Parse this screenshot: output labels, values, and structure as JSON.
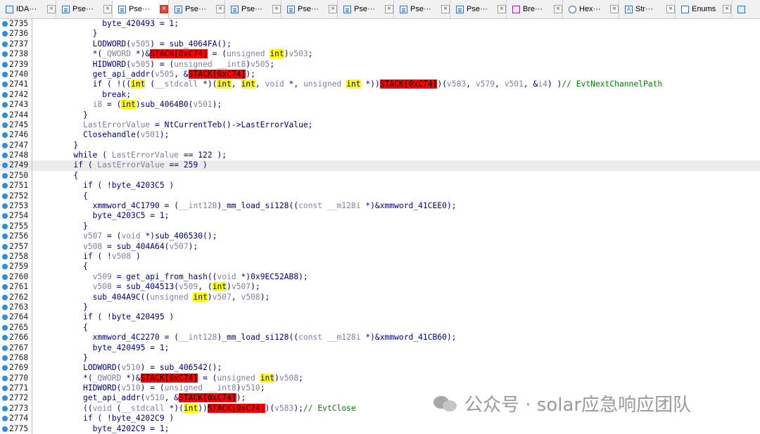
{
  "tabs": [
    {
      "label": "IDA···",
      "icon": "ida-view-icon",
      "active": false
    },
    {
      "label": "Pse···",
      "icon": "pseudocode-icon",
      "active": false
    },
    {
      "label": "Pse···",
      "icon": "pseudocode-icon",
      "active": true
    },
    {
      "label": "Pse···",
      "icon": "pseudocode-icon",
      "active": false
    },
    {
      "label": "Pse···",
      "icon": "pseudocode-icon",
      "active": false
    },
    {
      "label": "Pse···",
      "icon": "pseudocode-icon",
      "active": false
    },
    {
      "label": "Pse···",
      "icon": "pseudocode-icon",
      "active": false
    },
    {
      "label": "Pse···",
      "icon": "pseudocode-icon",
      "active": false
    },
    {
      "label": "Pse···",
      "icon": "pseudocode-icon",
      "active": false
    },
    {
      "label": "Bre···",
      "icon": "breakpoints-icon",
      "active": false
    },
    {
      "label": "Hex···",
      "icon": "hex-view-icon",
      "active": false
    },
    {
      "label": "Str···",
      "icon": "strings-icon",
      "active": false
    },
    {
      "label": "Enums",
      "icon": "enums-icon",
      "active": false
    },
    {
      "label": "",
      "icon": "tab-icon",
      "active": false
    }
  ],
  "highlighted_line": 2749,
  "lines": [
    {
      "n": 2735,
      "t": [
        [
          "p",
          "              byte_420493 = 1;"
        ]
      ]
    },
    {
      "n": 2736,
      "t": [
        [
          "p",
          "            }"
        ]
      ]
    },
    {
      "n": 2737,
      "t": [
        [
          "p",
          "            LODWORD("
        ],
        [
          "v",
          "v505"
        ],
        [
          "p",
          ") = sub_4064FA();"
        ]
      ]
    },
    {
      "n": 2738,
      "t": [
        [
          "p",
          "            *("
        ],
        [
          "v",
          "_QWORD"
        ],
        [
          "p",
          " *)&"
        ],
        [
          "s",
          "STACK[0xC74]"
        ],
        [
          "p",
          " = ("
        ],
        [
          "v",
          "unsigned"
        ],
        [
          "p",
          " "
        ],
        [
          "k",
          "int"
        ],
        [
          "p",
          ")"
        ],
        [
          "v",
          "v503"
        ],
        [
          "p",
          ";"
        ]
      ]
    },
    {
      "n": 2739,
      "t": [
        [
          "p",
          "            HIDWORD("
        ],
        [
          "v",
          "v505"
        ],
        [
          "p",
          ") = ("
        ],
        [
          "v",
          "unsigned __int8"
        ],
        [
          "p",
          ")"
        ],
        [
          "v",
          "v505"
        ],
        [
          "p",
          ";"
        ]
      ]
    },
    {
      "n": 2740,
      "t": [
        [
          "p",
          "            get_api_addr("
        ],
        [
          "v",
          "v505"
        ],
        [
          "p",
          ", &"
        ],
        [
          "s",
          "STACK[0xC74]"
        ],
        [
          "p",
          ");"
        ]
      ]
    },
    {
      "n": 2741,
      "t": [
        [
          "p",
          "            if ( !(("
        ],
        [
          "k",
          "int"
        ],
        [
          "p",
          " ("
        ],
        [
          "v",
          "__stdcall"
        ],
        [
          "p",
          " *)("
        ],
        [
          "k",
          "int"
        ],
        [
          "p",
          ", "
        ],
        [
          "k",
          "int"
        ],
        [
          "p",
          ", "
        ],
        [
          "v",
          "void"
        ],
        [
          "p",
          " *, "
        ],
        [
          "v",
          "unsigned"
        ],
        [
          "p",
          " "
        ],
        [
          "k",
          "int"
        ],
        [
          "p",
          " *))"
        ],
        [
          "s",
          "STACK[0xC74]"
        ],
        [
          "p",
          ")("
        ],
        [
          "v",
          "v583"
        ],
        [
          "p",
          ", "
        ],
        [
          "v",
          "v579"
        ],
        [
          "p",
          ", "
        ],
        [
          "v",
          "v501"
        ],
        [
          "p",
          ", &"
        ],
        [
          "v",
          "i4"
        ],
        [
          "p",
          ") )"
        ],
        [
          "c",
          "// EvtNextChannelPath"
        ]
      ]
    },
    {
      "n": 2742,
      "t": [
        [
          "p",
          "              break;"
        ]
      ]
    },
    {
      "n": 2743,
      "t": [
        [
          "p",
          "            "
        ],
        [
          "v",
          "i8"
        ],
        [
          "p",
          " = ("
        ],
        [
          "k",
          "int"
        ],
        [
          "p",
          ")sub_4064B0("
        ],
        [
          "v",
          "v501"
        ],
        [
          "p",
          ");"
        ]
      ]
    },
    {
      "n": 2744,
      "t": [
        [
          "p",
          "          }"
        ]
      ]
    },
    {
      "n": 2745,
      "t": [
        [
          "p",
          "          "
        ],
        [
          "v",
          "LastErrorValue"
        ],
        [
          "p",
          " = NtCurrentTeb()->LastErrorValue;"
        ]
      ]
    },
    {
      "n": 2746,
      "t": [
        [
          "p",
          "          Closehandle("
        ],
        [
          "v",
          "v501"
        ],
        [
          "p",
          ");"
        ]
      ]
    },
    {
      "n": 2747,
      "t": [
        [
          "p",
          "        }"
        ]
      ]
    },
    {
      "n": 2748,
      "t": [
        [
          "p",
          "        while ( "
        ],
        [
          "v",
          "LastErrorValue"
        ],
        [
          "p",
          " == 122 );"
        ]
      ]
    },
    {
      "n": 2749,
      "t": [
        [
          "p",
          "        if ( "
        ],
        [
          "v",
          "LastErrorValue"
        ],
        [
          "p",
          " == 259 )"
        ]
      ]
    },
    {
      "n": 2750,
      "t": [
        [
          "p",
          "        {"
        ]
      ]
    },
    {
      "n": 2751,
      "t": [
        [
          "p",
          "          if ( !byte_4203C5 )"
        ]
      ]
    },
    {
      "n": 2752,
      "t": [
        [
          "p",
          "          {"
        ]
      ]
    },
    {
      "n": 2753,
      "t": [
        [
          "p",
          "            xmmword_4C1790 = ("
        ],
        [
          "v",
          "__int128"
        ],
        [
          "p",
          ")_mm_load_si128(("
        ],
        [
          "v",
          "const __m128i"
        ],
        [
          "p",
          " *)&xmmword_41CEE0);"
        ]
      ]
    },
    {
      "n": 2754,
      "t": [
        [
          "p",
          "            byte_4203C5 = 1;"
        ]
      ]
    },
    {
      "n": 2755,
      "t": [
        [
          "p",
          "          }"
        ]
      ]
    },
    {
      "n": 2756,
      "t": [
        [
          "p",
          "          "
        ],
        [
          "v",
          "v507"
        ],
        [
          "p",
          " = ("
        ],
        [
          "v",
          "void"
        ],
        [
          "p",
          " *)sub_406530();"
        ]
      ]
    },
    {
      "n": 2757,
      "t": [
        [
          "p",
          "          "
        ],
        [
          "v",
          "v508"
        ],
        [
          "p",
          " = sub_404A64("
        ],
        [
          "v",
          "v507"
        ],
        [
          "p",
          ");"
        ]
      ]
    },
    {
      "n": 2758,
      "t": [
        [
          "p",
          "          if ( !"
        ],
        [
          "v",
          "v508"
        ],
        [
          "p",
          " )"
        ]
      ]
    },
    {
      "n": 2759,
      "t": [
        [
          "p",
          "          {"
        ]
      ]
    },
    {
      "n": 2760,
      "t": [
        [
          "p",
          "            "
        ],
        [
          "v",
          "v509"
        ],
        [
          "p",
          " = get_api_from_hash(("
        ],
        [
          "v",
          "void"
        ],
        [
          "p",
          " *)0x9EC52AB8);"
        ]
      ]
    },
    {
      "n": 2761,
      "t": [
        [
          "p",
          "            "
        ],
        [
          "v",
          "v508"
        ],
        [
          "p",
          " = sub_404513("
        ],
        [
          "v",
          "v509"
        ],
        [
          "p",
          ", ("
        ],
        [
          "k",
          "int"
        ],
        [
          "p",
          ")"
        ],
        [
          "v",
          "v507"
        ],
        [
          "p",
          ");"
        ]
      ]
    },
    {
      "n": 2762,
      "t": [
        [
          "p",
          "            sub_404A9C(("
        ],
        [
          "v",
          "unsigned"
        ],
        [
          "p",
          " "
        ],
        [
          "k",
          "int"
        ],
        [
          "p",
          ")"
        ],
        [
          "v",
          "v507"
        ],
        [
          "p",
          ", "
        ],
        [
          "v",
          "v508"
        ],
        [
          "p",
          ");"
        ]
      ]
    },
    {
      "n": 2763,
      "t": [
        [
          "p",
          "          }"
        ]
      ]
    },
    {
      "n": 2764,
      "t": [
        [
          "p",
          "          if ( !byte_420495 )"
        ]
      ]
    },
    {
      "n": 2765,
      "t": [
        [
          "p",
          "          {"
        ]
      ]
    },
    {
      "n": 2766,
      "t": [
        [
          "p",
          "            xmmword_4C2270 = ("
        ],
        [
          "v",
          "__int128"
        ],
        [
          "p",
          ")_mm_load_si128(("
        ],
        [
          "v",
          "const __m128i"
        ],
        [
          "p",
          " *)&xmmword_41CB60);"
        ]
      ]
    },
    {
      "n": 2767,
      "t": [
        [
          "p",
          "            byte_420495 = 1;"
        ]
      ]
    },
    {
      "n": 2768,
      "t": [
        [
          "p",
          "          }"
        ]
      ]
    },
    {
      "n": 2769,
      "t": [
        [
          "p",
          "          LODWORD("
        ],
        [
          "v",
          "v510"
        ],
        [
          "p",
          ") = sub_406542();"
        ]
      ]
    },
    {
      "n": 2770,
      "t": [
        [
          "p",
          "          *("
        ],
        [
          "v",
          "_QWORD"
        ],
        [
          "p",
          " *)&"
        ],
        [
          "s",
          "STACK[0xC74]"
        ],
        [
          "p",
          " = ("
        ],
        [
          "v",
          "unsigned"
        ],
        [
          "p",
          " "
        ],
        [
          "k",
          "int"
        ],
        [
          "p",
          ")"
        ],
        [
          "v",
          "v508"
        ],
        [
          "p",
          ";"
        ]
      ]
    },
    {
      "n": 2771,
      "t": [
        [
          "p",
          "          HIDWORD("
        ],
        [
          "v",
          "v510"
        ],
        [
          "p",
          ") = ("
        ],
        [
          "v",
          "unsigned __int8"
        ],
        [
          "p",
          ")"
        ],
        [
          "v",
          "v510"
        ],
        [
          "p",
          ";"
        ]
      ]
    },
    {
      "n": 2772,
      "t": [
        [
          "p",
          "          get_api_addr("
        ],
        [
          "v",
          "v510"
        ],
        [
          "p",
          ", &"
        ],
        [
          "s",
          "STACK[0xC74]"
        ],
        [
          "p",
          ");"
        ]
      ]
    },
    {
      "n": 2773,
      "t": [
        [
          "p",
          "          (("
        ],
        [
          "v",
          "void"
        ],
        [
          "p",
          " ("
        ],
        [
          "v",
          "__stdcall"
        ],
        [
          "p",
          " *)("
        ],
        [
          "k",
          "int"
        ],
        [
          "p",
          "))"
        ],
        [
          "s",
          "STACK[0xC74]"
        ],
        [
          "p",
          ")("
        ],
        [
          "v",
          "v583"
        ],
        [
          "p",
          ");"
        ],
        [
          "c",
          "// EvtClose"
        ]
      ]
    },
    {
      "n": 2774,
      "t": [
        [
          "p",
          "          if ( !byte_4202C9 )"
        ]
      ]
    },
    {
      "n": 2775,
      "t": [
        [
          "p",
          "            byte_4202C9 = 1;"
        ]
      ]
    }
  ],
  "watermark": {
    "text": "公众号 · solar应急响应团队",
    "icon": "wechat-logo-icon"
  },
  "colors": {
    "keyword_highlight": "#ffff00",
    "stack_highlight": "#ff0000",
    "variable": "#8080a0",
    "comment": "#008000",
    "plain": "#000080",
    "breakpoint_dot": "#2a8ee3"
  }
}
